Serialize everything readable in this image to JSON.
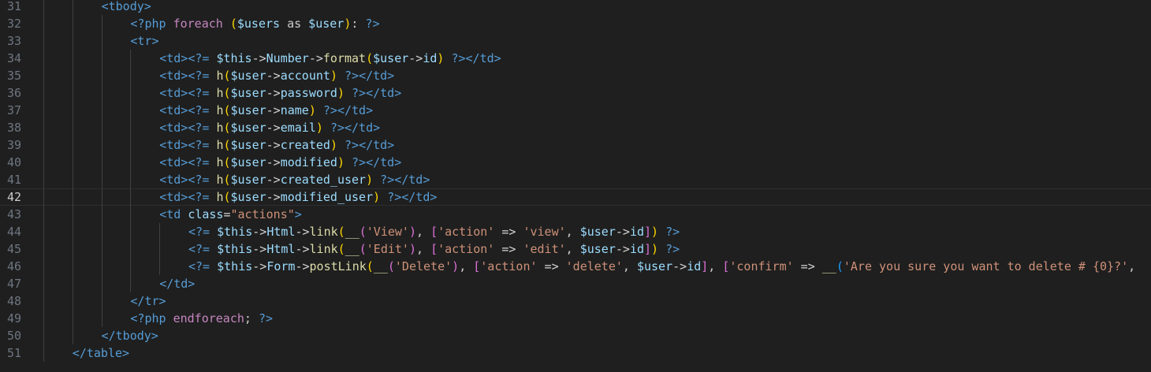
{
  "editor": {
    "current_line": 42,
    "indent_unit_chars": 4,
    "lines": [
      {
        "n": 31,
        "indent": 2,
        "tokens": [
          [
            "<",
            "t-tag"
          ],
          [
            "tbody",
            "t-tag"
          ],
          [
            ">",
            "t-tag"
          ]
        ]
      },
      {
        "n": 32,
        "indent": 3,
        "tokens": [
          [
            "<?php",
            "t-kw"
          ],
          [
            " ",
            "t-txt"
          ],
          [
            "foreach",
            "t-ctl"
          ],
          [
            " ",
            "t-txt"
          ],
          [
            "(",
            "t-b1"
          ],
          [
            "$users",
            "t-var"
          ],
          [
            " as ",
            "t-txt"
          ],
          [
            "$user",
            "t-var"
          ],
          [
            ")",
            "t-b1"
          ],
          [
            ": ",
            "t-txt"
          ],
          [
            "?>",
            "t-kw"
          ]
        ]
      },
      {
        "n": 33,
        "indent": 3,
        "tokens": [
          [
            "<",
            "t-tag"
          ],
          [
            "tr",
            "t-tag"
          ],
          [
            ">",
            "t-tag"
          ]
        ]
      },
      {
        "n": 34,
        "indent": 4,
        "tokens": [
          [
            "<td>",
            "t-tag"
          ],
          [
            "<?=",
            "t-kw"
          ],
          [
            " ",
            "t-txt"
          ],
          [
            "$this",
            "t-var"
          ],
          [
            "->",
            "t-op"
          ],
          [
            "Number",
            "t-prop"
          ],
          [
            "->",
            "t-op"
          ],
          [
            "format",
            "t-fn"
          ],
          [
            "(",
            "t-b1"
          ],
          [
            "$user",
            "t-var"
          ],
          [
            "->",
            "t-op"
          ],
          [
            "id",
            "t-prop"
          ],
          [
            ")",
            "t-b1"
          ],
          [
            " ",
            "t-txt"
          ],
          [
            "?>",
            "t-kw"
          ],
          [
            "</td>",
            "t-tag"
          ]
        ]
      },
      {
        "n": 35,
        "indent": 4,
        "tokens": [
          [
            "<td>",
            "t-tag"
          ],
          [
            "<?=",
            "t-kw"
          ],
          [
            " ",
            "t-txt"
          ],
          [
            "h",
            "t-fn"
          ],
          [
            "(",
            "t-b1"
          ],
          [
            "$user",
            "t-var"
          ],
          [
            "->",
            "t-op"
          ],
          [
            "account",
            "t-prop"
          ],
          [
            ")",
            "t-b1"
          ],
          [
            " ",
            "t-txt"
          ],
          [
            "?>",
            "t-kw"
          ],
          [
            "</td>",
            "t-tag"
          ]
        ]
      },
      {
        "n": 36,
        "indent": 4,
        "tokens": [
          [
            "<td>",
            "t-tag"
          ],
          [
            "<?=",
            "t-kw"
          ],
          [
            " ",
            "t-txt"
          ],
          [
            "h",
            "t-fn"
          ],
          [
            "(",
            "t-b1"
          ],
          [
            "$user",
            "t-var"
          ],
          [
            "->",
            "t-op"
          ],
          [
            "password",
            "t-prop"
          ],
          [
            ")",
            "t-b1"
          ],
          [
            " ",
            "t-txt"
          ],
          [
            "?>",
            "t-kw"
          ],
          [
            "</td>",
            "t-tag"
          ]
        ]
      },
      {
        "n": 37,
        "indent": 4,
        "tokens": [
          [
            "<td>",
            "t-tag"
          ],
          [
            "<?=",
            "t-kw"
          ],
          [
            " ",
            "t-txt"
          ],
          [
            "h",
            "t-fn"
          ],
          [
            "(",
            "t-b1"
          ],
          [
            "$user",
            "t-var"
          ],
          [
            "->",
            "t-op"
          ],
          [
            "name",
            "t-prop"
          ],
          [
            ")",
            "t-b1"
          ],
          [
            " ",
            "t-txt"
          ],
          [
            "?>",
            "t-kw"
          ],
          [
            "</td>",
            "t-tag"
          ]
        ]
      },
      {
        "n": 38,
        "indent": 4,
        "tokens": [
          [
            "<td>",
            "t-tag"
          ],
          [
            "<?=",
            "t-kw"
          ],
          [
            " ",
            "t-txt"
          ],
          [
            "h",
            "t-fn"
          ],
          [
            "(",
            "t-b1"
          ],
          [
            "$user",
            "t-var"
          ],
          [
            "->",
            "t-op"
          ],
          [
            "email",
            "t-prop"
          ],
          [
            ")",
            "t-b1"
          ],
          [
            " ",
            "t-txt"
          ],
          [
            "?>",
            "t-kw"
          ],
          [
            "</td>",
            "t-tag"
          ]
        ]
      },
      {
        "n": 39,
        "indent": 4,
        "tokens": [
          [
            "<td>",
            "t-tag"
          ],
          [
            "<?=",
            "t-kw"
          ],
          [
            " ",
            "t-txt"
          ],
          [
            "h",
            "t-fn"
          ],
          [
            "(",
            "t-b1"
          ],
          [
            "$user",
            "t-var"
          ],
          [
            "->",
            "t-op"
          ],
          [
            "created",
            "t-prop"
          ],
          [
            ")",
            "t-b1"
          ],
          [
            " ",
            "t-txt"
          ],
          [
            "?>",
            "t-kw"
          ],
          [
            "</td>",
            "t-tag"
          ]
        ]
      },
      {
        "n": 40,
        "indent": 4,
        "tokens": [
          [
            "<td>",
            "t-tag"
          ],
          [
            "<?=",
            "t-kw"
          ],
          [
            " ",
            "t-txt"
          ],
          [
            "h",
            "t-fn"
          ],
          [
            "(",
            "t-b1"
          ],
          [
            "$user",
            "t-var"
          ],
          [
            "->",
            "t-op"
          ],
          [
            "modified",
            "t-prop"
          ],
          [
            ")",
            "t-b1"
          ],
          [
            " ",
            "t-txt"
          ],
          [
            "?>",
            "t-kw"
          ],
          [
            "</td>",
            "t-tag"
          ]
        ]
      },
      {
        "n": 41,
        "indent": 4,
        "tokens": [
          [
            "<td>",
            "t-tag"
          ],
          [
            "<?=",
            "t-kw"
          ],
          [
            " ",
            "t-txt"
          ],
          [
            "h",
            "t-fn"
          ],
          [
            "(",
            "t-b1"
          ],
          [
            "$user",
            "t-var"
          ],
          [
            "->",
            "t-op"
          ],
          [
            "created_user",
            "t-prop"
          ],
          [
            ")",
            "t-b1"
          ],
          [
            " ",
            "t-txt"
          ],
          [
            "?>",
            "t-kw"
          ],
          [
            "</td>",
            "t-tag"
          ]
        ]
      },
      {
        "n": 42,
        "indent": 4,
        "tokens": [
          [
            "<td>",
            "t-tag"
          ],
          [
            "<?=",
            "t-kw"
          ],
          [
            " ",
            "t-txt"
          ],
          [
            "h",
            "t-fn"
          ],
          [
            "(",
            "t-b1"
          ],
          [
            "$user",
            "t-var"
          ],
          [
            "->",
            "t-op"
          ],
          [
            "modified_user",
            "t-prop"
          ],
          [
            ")",
            "t-b1"
          ],
          [
            " ",
            "t-txt"
          ],
          [
            "?>",
            "t-kw"
          ],
          [
            "</td>",
            "t-tag"
          ]
        ]
      },
      {
        "n": 43,
        "indent": 4,
        "tokens": [
          [
            "<td",
            "t-tag"
          ],
          [
            " ",
            "t-txt"
          ],
          [
            "class",
            "t-attr"
          ],
          [
            "=",
            "t-op"
          ],
          [
            "\"actions\"",
            "t-str"
          ],
          [
            ">",
            "t-tag"
          ]
        ]
      },
      {
        "n": 44,
        "indent": 5,
        "tokens": [
          [
            "<?=",
            "t-kw"
          ],
          [
            " ",
            "t-txt"
          ],
          [
            "$this",
            "t-var"
          ],
          [
            "->",
            "t-op"
          ],
          [
            "Html",
            "t-prop"
          ],
          [
            "->",
            "t-op"
          ],
          [
            "link",
            "t-fn"
          ],
          [
            "(",
            "t-b1"
          ],
          [
            "__",
            "t-fn"
          ],
          [
            "(",
            "t-b2"
          ],
          [
            "'View'",
            "t-str"
          ],
          [
            ")",
            "t-b2"
          ],
          [
            ", ",
            "t-txt"
          ],
          [
            "[",
            "t-b2"
          ],
          [
            "'action'",
            "t-str"
          ],
          [
            " => ",
            "t-op"
          ],
          [
            "'view'",
            "t-str"
          ],
          [
            ", ",
            "t-txt"
          ],
          [
            "$user",
            "t-var"
          ],
          [
            "->",
            "t-op"
          ],
          [
            "id",
            "t-prop"
          ],
          [
            "]",
            "t-b2"
          ],
          [
            ")",
            "t-b1"
          ],
          [
            " ",
            "t-txt"
          ],
          [
            "?>",
            "t-kw"
          ]
        ]
      },
      {
        "n": 45,
        "indent": 5,
        "tokens": [
          [
            "<?=",
            "t-kw"
          ],
          [
            " ",
            "t-txt"
          ],
          [
            "$this",
            "t-var"
          ],
          [
            "->",
            "t-op"
          ],
          [
            "Html",
            "t-prop"
          ],
          [
            "->",
            "t-op"
          ],
          [
            "link",
            "t-fn"
          ],
          [
            "(",
            "t-b1"
          ],
          [
            "__",
            "t-fn"
          ],
          [
            "(",
            "t-b2"
          ],
          [
            "'Edit'",
            "t-str"
          ],
          [
            ")",
            "t-b2"
          ],
          [
            ", ",
            "t-txt"
          ],
          [
            "[",
            "t-b2"
          ],
          [
            "'action'",
            "t-str"
          ],
          [
            " => ",
            "t-op"
          ],
          [
            "'edit'",
            "t-str"
          ],
          [
            ", ",
            "t-txt"
          ],
          [
            "$user",
            "t-var"
          ],
          [
            "->",
            "t-op"
          ],
          [
            "id",
            "t-prop"
          ],
          [
            "]",
            "t-b2"
          ],
          [
            ")",
            "t-b1"
          ],
          [
            " ",
            "t-txt"
          ],
          [
            "?>",
            "t-kw"
          ]
        ]
      },
      {
        "n": 46,
        "indent": 5,
        "tokens": [
          [
            "<?=",
            "t-kw"
          ],
          [
            " ",
            "t-txt"
          ],
          [
            "$this",
            "t-var"
          ],
          [
            "->",
            "t-op"
          ],
          [
            "Form",
            "t-prop"
          ],
          [
            "->",
            "t-op"
          ],
          [
            "postLink",
            "t-fn"
          ],
          [
            "(",
            "t-b1"
          ],
          [
            "__",
            "t-fn"
          ],
          [
            "(",
            "t-b2"
          ],
          [
            "'Delete'",
            "t-str"
          ],
          [
            ")",
            "t-b2"
          ],
          [
            ", ",
            "t-txt"
          ],
          [
            "[",
            "t-b2"
          ],
          [
            "'action'",
            "t-str"
          ],
          [
            " => ",
            "t-op"
          ],
          [
            "'delete'",
            "t-str"
          ],
          [
            ", ",
            "t-txt"
          ],
          [
            "$user",
            "t-var"
          ],
          [
            "->",
            "t-op"
          ],
          [
            "id",
            "t-prop"
          ],
          [
            "]",
            "t-b2"
          ],
          [
            ", ",
            "t-txt"
          ],
          [
            "[",
            "t-b2"
          ],
          [
            "'confirm'",
            "t-str"
          ],
          [
            " => ",
            "t-op"
          ],
          [
            "__",
            "t-fn"
          ],
          [
            "(",
            "t-b3"
          ],
          [
            "'Are you sure you want to delete # {0}?'",
            "t-str"
          ],
          [
            ",",
            "t-txt"
          ]
        ]
      },
      {
        "n": 47,
        "indent": 4,
        "tokens": [
          [
            "</td>",
            "t-tag"
          ]
        ]
      },
      {
        "n": 48,
        "indent": 3,
        "tokens": [
          [
            "</tr>",
            "t-tag"
          ]
        ]
      },
      {
        "n": 49,
        "indent": 3,
        "tokens": [
          [
            "<?php",
            "t-kw"
          ],
          [
            " ",
            "t-txt"
          ],
          [
            "endforeach",
            "t-ctl"
          ],
          [
            "; ",
            "t-txt"
          ],
          [
            "?>",
            "t-kw"
          ]
        ]
      },
      {
        "n": 50,
        "indent": 2,
        "tokens": [
          [
            "</tbody>",
            "t-tag"
          ]
        ]
      },
      {
        "n": 51,
        "indent": 1,
        "tokens": [
          [
            "</table>",
            "t-tag"
          ]
        ]
      }
    ]
  }
}
